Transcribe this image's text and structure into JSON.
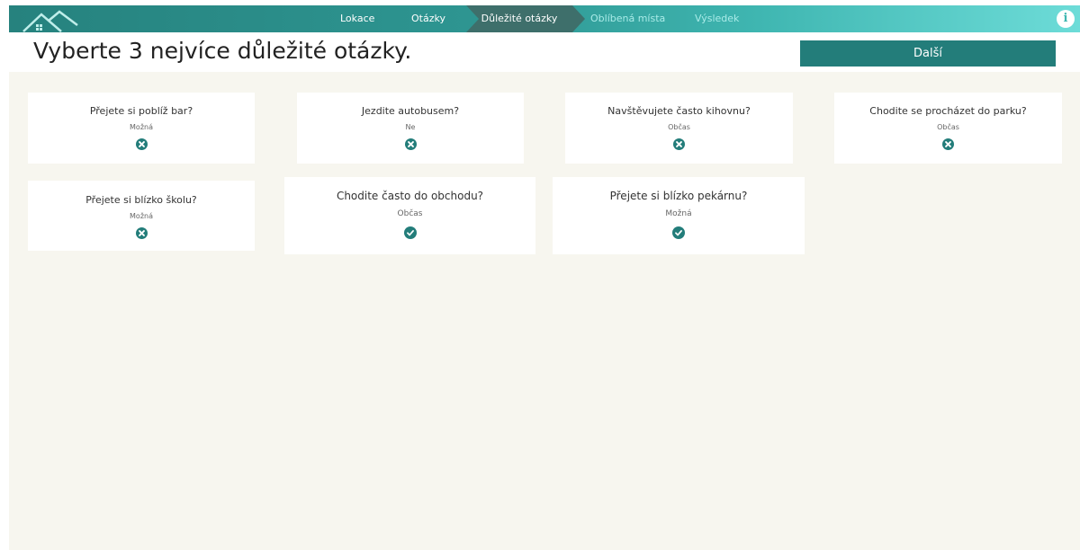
{
  "nav": {
    "steps": [
      "Lokace",
      "Otázky",
      "Důležité otázky",
      "Oblíbená místa",
      "Výsledek"
    ],
    "info_glyph": "i",
    "colors": {
      "primary": "#237d7a",
      "accent_light": "#6ddcd8",
      "background": "#f7f6ef"
    }
  },
  "header": {
    "title": "Vyberte 3 nejvíce důležité otázky.",
    "next_label": "Další"
  },
  "cards": [
    {
      "question": "Přejete si poblíž bar?",
      "answer": "Možná",
      "state_icon": "remove-icon",
      "selected": false
    },
    {
      "question": "Jezdite autobusem?",
      "answer": "Ne",
      "state_icon": "remove-icon",
      "selected": false
    },
    {
      "question": "Navštěvujete často kihovnu?",
      "answer": "Občas",
      "state_icon": "remove-icon",
      "selected": false
    },
    {
      "question": "Chodite se procházet do parku?",
      "answer": "Občas",
      "state_icon": "remove-icon",
      "selected": false
    },
    {
      "question": "Přejete si blízko školu?",
      "answer": "Možná",
      "state_icon": "remove-icon",
      "selected": false
    },
    {
      "question": "Chodite často do obchodu?",
      "answer": "Občas",
      "state_icon": "check-icon",
      "selected": true
    },
    {
      "question": "Přejete si blízko pekárnu?",
      "answer": "Možná",
      "state_icon": "check-icon",
      "selected": true
    }
  ]
}
